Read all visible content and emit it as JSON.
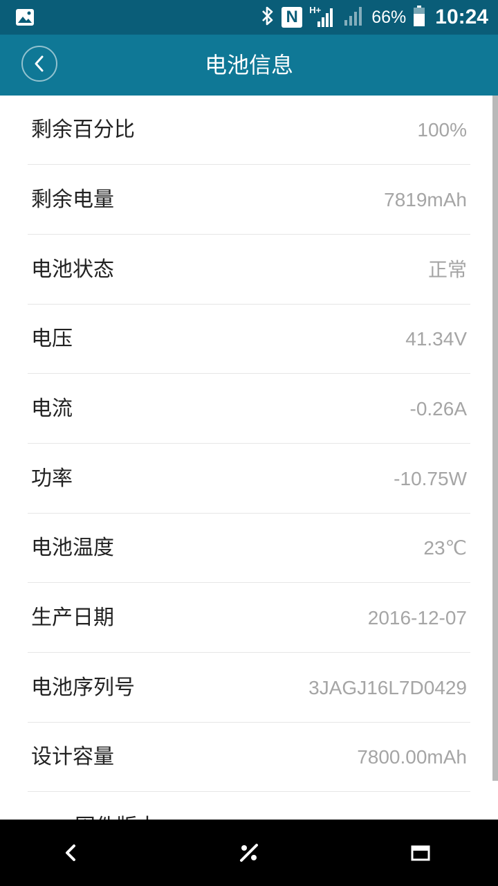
{
  "status_bar": {
    "battery_percent": "66%",
    "time": "10:24",
    "network_type": "H+",
    "nfc_label": "N",
    "icons": [
      "gallery-icon",
      "bluetooth-icon",
      "nfc-icon",
      "signal-icon",
      "battery-icon"
    ]
  },
  "header": {
    "title": "电池信息",
    "back_icon": "chevron-left-icon"
  },
  "rows": [
    {
      "label": "剩余百分比",
      "value": "100%"
    },
    {
      "label": "剩余电量",
      "value": "7819mAh"
    },
    {
      "label": "电池状态",
      "value": "正常"
    },
    {
      "label": "电压",
      "value": "41.34V"
    },
    {
      "label": "电流",
      "value": "-0.26A"
    },
    {
      "label": "功率",
      "value": "-10.75W"
    },
    {
      "label": "电池温度",
      "value": "23℃"
    },
    {
      "label": "生产日期",
      "value": "2016-12-07"
    },
    {
      "label": "电池序列号",
      "value": "3JAGJ16L7D0429"
    },
    {
      "label": "设计容量",
      "value": "7800.00mAh"
    },
    {
      "label": "固件版本",
      "value": ""
    }
  ],
  "nav_bar": {
    "icons": [
      "back-icon",
      "mode-icon",
      "recents-icon"
    ]
  },
  "colors": {
    "status_bar": "#0a5d78",
    "app_bar": "#0f7896",
    "label_text": "#222222",
    "value_text": "#a5a5a5",
    "divider": "#e6e6e6"
  }
}
